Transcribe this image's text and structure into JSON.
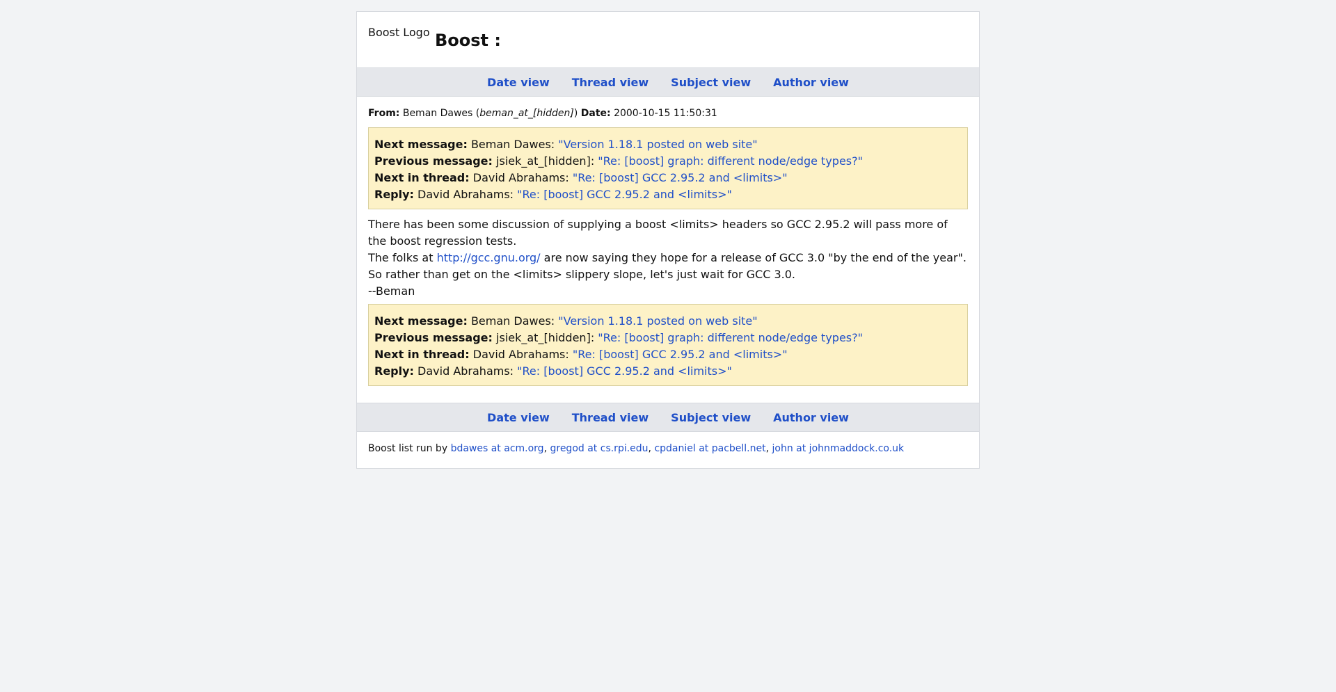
{
  "header": {
    "logo_alt": "Boost Logo",
    "title": "Boost :"
  },
  "nav": {
    "date": "Date view",
    "thread": "Thread view",
    "subject": "Subject view",
    "author": "Author view"
  },
  "message": {
    "from_label": "From:",
    "from_name": "Beman Dawes (",
    "from_email": "beman_at_[hidden]",
    "from_close": ")",
    "date_label": "Date:",
    "date_value": "2000-10-15 11:50:31"
  },
  "links": {
    "next_message": {
      "label": "Next message:",
      "author": "Beman Dawes:",
      "subject": "\"Version 1.18.1 posted on web site\""
    },
    "previous_message": {
      "label": "Previous message:",
      "author": "jsiek_at_[hidden]:",
      "subject": "\"Re: [boost] graph: different node/edge types?\""
    },
    "next_in_thread": {
      "label": "Next in thread:",
      "author": "David Abrahams:",
      "subject": "\"Re: [boost] GCC 2.95.2 and <limits>\""
    },
    "reply": {
      "label": "Reply:",
      "author": "David Abrahams:",
      "subject": "\"Re: [boost] GCC 2.95.2 and <limits>\""
    }
  },
  "body": {
    "line1": "There has been some discussion of supplying a boost <limits> headers so GCC 2.95.2 will pass more of the boost regression tests.",
    "line2_pre": "The folks at ",
    "line2_link": "http://gcc.gnu.org/",
    "line2_post": " are now saying they hope for a release of GCC 3.0 \"by the end of the year\".",
    "line3": "So rather than get on the <limits> slippery slope, let's just wait for GCC 3.0.",
    "line4": "--Beman"
  },
  "footer": {
    "prefix": "Boost list run by ",
    "maintainers": [
      "bdawes at acm.org",
      "gregod at cs.rpi.edu",
      "cpdaniel at pacbell.net",
      "john at johnmaddock.co.uk"
    ],
    "sep": ", "
  }
}
